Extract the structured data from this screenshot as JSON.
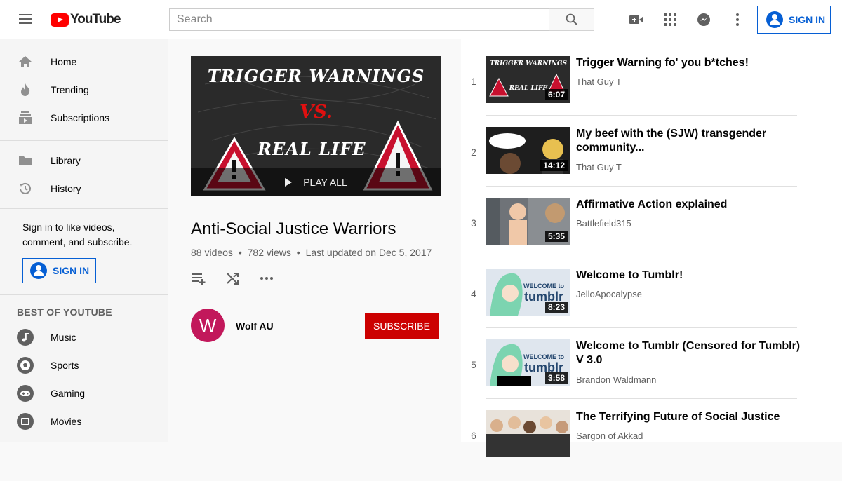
{
  "header": {
    "logo_text": "YouTube",
    "search_placeholder": "Search",
    "signin_label": "SIGN IN",
    "icons": [
      "menu-icon",
      "search-icon",
      "video-camera-icon",
      "apps-grid-icon",
      "messages-icon",
      "more-vert-icon",
      "account-icon"
    ]
  },
  "sidebar": {
    "main_items": [
      {
        "label": "Home",
        "icon": "home-icon"
      },
      {
        "label": "Trending",
        "icon": "flame-icon"
      },
      {
        "label": "Subscriptions",
        "icon": "subscriptions-icon"
      }
    ],
    "library_items": [
      {
        "label": "Library",
        "icon": "folder-icon"
      },
      {
        "label": "History",
        "icon": "history-icon"
      }
    ],
    "signin_prompt": "Sign in to like videos, comment, and subscribe.",
    "signin_label": "SIGN IN",
    "best_heading": "BEST OF YOUTUBE",
    "best_items": [
      {
        "label": "Music",
        "icon": "music-icon"
      },
      {
        "label": "Sports",
        "icon": "sports-icon"
      },
      {
        "label": "Gaming",
        "icon": "gaming-icon"
      },
      {
        "label": "Movies",
        "icon": "movies-icon"
      }
    ]
  },
  "playlist": {
    "hero_line1": "TRIGGER WARNINGS",
    "hero_vs": "VS.",
    "hero_line2": "REAL LIFE",
    "play_all": "PLAY ALL",
    "title": "Anti-Social Justice Warriors",
    "video_count": "88 videos",
    "views": "782 views",
    "updated": "Last updated on Dec 5, 2017",
    "separator": "•",
    "owner_initial": "W",
    "owner_name": "Wolf AU",
    "subscribe_label": "SUBSCRIBE"
  },
  "videos": [
    {
      "index": "1",
      "title": "Trigger Warning fo' you b*tches!",
      "channel": "That Guy T",
      "duration": "6:07",
      "thumb_color": "#2b2b2b"
    },
    {
      "index": "2",
      "title": "My beef with the (SJW) transgender community...",
      "channel": "That Guy T",
      "duration": "14:12",
      "thumb_color": "#1e1e1e"
    },
    {
      "index": "3",
      "title": "Affirmative Action explained",
      "channel": "Battlefield315",
      "duration": "5:35",
      "thumb_color": "#6f7378"
    },
    {
      "index": "4",
      "title": "Welcome to Tumblr!",
      "channel": "JelloApocalypse",
      "duration": "8:23",
      "thumb_color": "#dfe6ee"
    },
    {
      "index": "5",
      "title": "Welcome to Tumblr (Censored for Tumblr) V 3.0",
      "channel": "Brandon Waldmann",
      "duration": "3:58",
      "thumb_color": "#dfe6ee"
    },
    {
      "index": "6",
      "title": "The Terrifying Future of Social Justice",
      "channel": "Sargon of Akkad",
      "duration": "",
      "thumb_color": "#e8e2da"
    }
  ],
  "colors": {
    "brand_red": "#ff0000",
    "link_blue": "#065fd4",
    "subscribe_red": "#cc0000",
    "owner_avatar": "#c2185b"
  }
}
